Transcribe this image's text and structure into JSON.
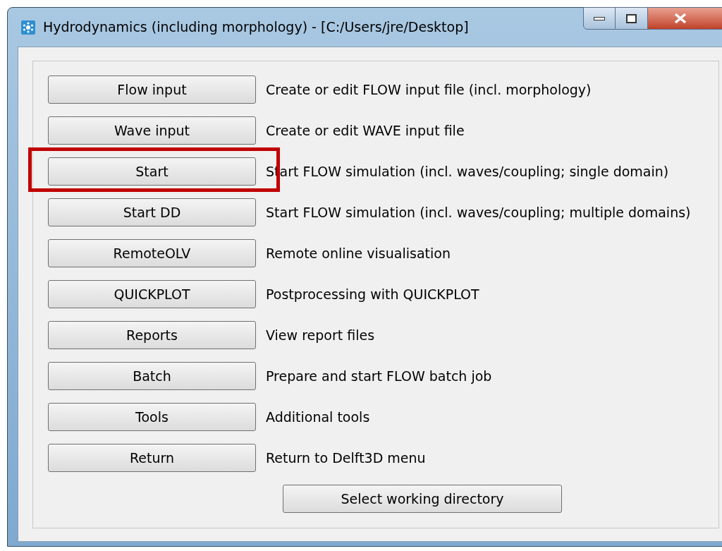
{
  "window": {
    "title": "Hydrodynamics (including morphology) - [C:/Users/jre/Desktop]"
  },
  "items": [
    {
      "button": "Flow input",
      "description": "Create or edit FLOW input file (incl. morphology)",
      "highlighted": false
    },
    {
      "button": "Wave input",
      "description": "Create or edit WAVE input file",
      "highlighted": false
    },
    {
      "button": "Start",
      "description": "Start FLOW simulation (incl. waves/coupling; single domain)",
      "highlighted": true
    },
    {
      "button": "Start DD",
      "description": "Start FLOW simulation (incl. waves/coupling; multiple domains)",
      "highlighted": false
    },
    {
      "button": "RemoteOLV",
      "description": "Remote online visualisation",
      "highlighted": false
    },
    {
      "button": "QUICKPLOT",
      "description": "Postprocessing with QUICKPLOT",
      "highlighted": false
    },
    {
      "button": "Reports",
      "description": "View report files",
      "highlighted": false
    },
    {
      "button": "Batch",
      "description": "Prepare and start FLOW batch job",
      "highlighted": false
    },
    {
      "button": "Tools",
      "description": "Additional tools",
      "highlighted": false
    },
    {
      "button": "Return",
      "description": "Return to Delft3D menu",
      "highlighted": false
    }
  ],
  "footer_button": "Select working directory"
}
